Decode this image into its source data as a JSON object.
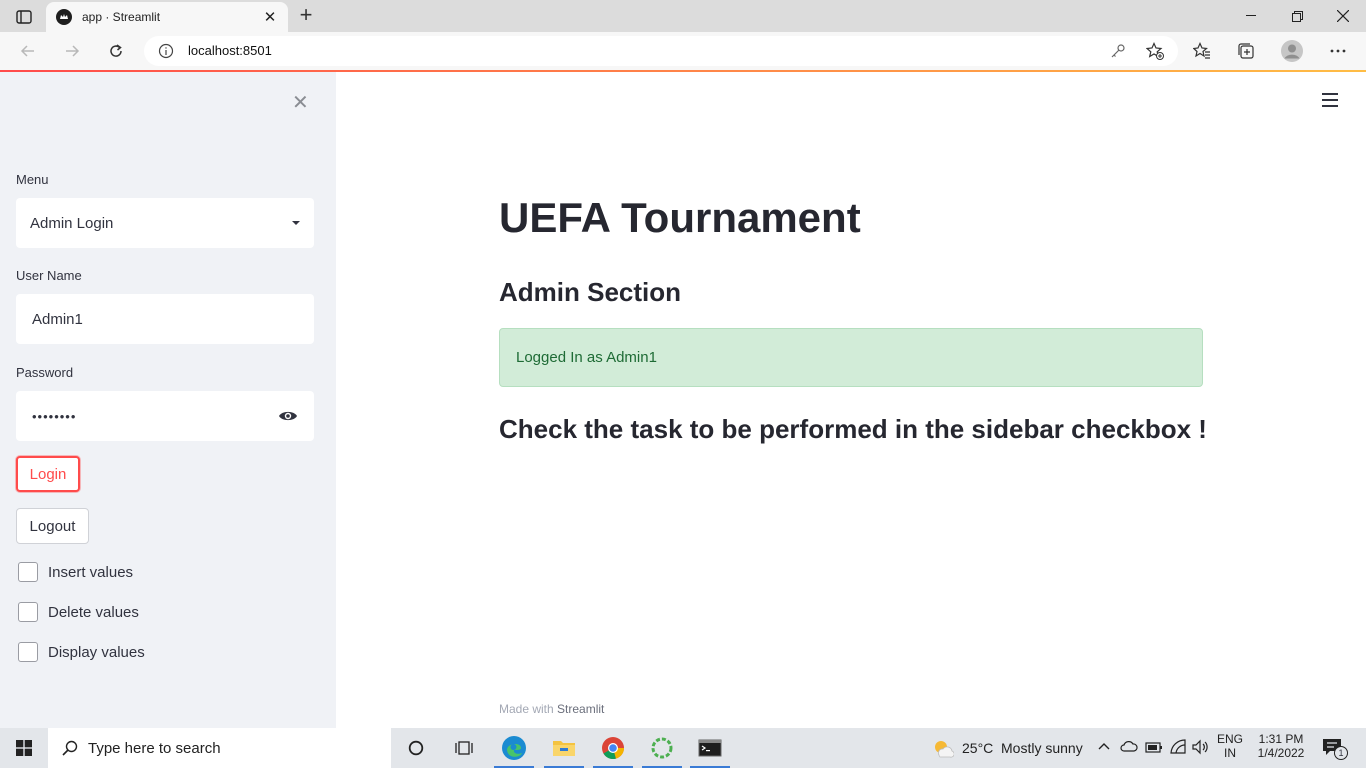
{
  "browser": {
    "tab_title": "app · Streamlit",
    "url": "localhost:8501"
  },
  "sidebar": {
    "menu_label": "Menu",
    "menu_value": "Admin Login",
    "username_label": "User Name",
    "username_value": "Admin1",
    "password_label": "Password",
    "password_value": "••••••••",
    "login_label": "Login",
    "logout_label": "Logout",
    "checkboxes": [
      {
        "label": "Insert values",
        "checked": false
      },
      {
        "label": "Delete values",
        "checked": false
      },
      {
        "label": "Display values",
        "checked": false
      }
    ]
  },
  "main": {
    "title": "UEFA Tournament",
    "subtitle": "Admin Section",
    "alert": "Logged In as Admin1",
    "task_text": "Check the task to be performed in the sidebar checkbox !",
    "footer_prefix": "Made with",
    "footer_brand": "Streamlit"
  },
  "taskbar": {
    "search_placeholder": "Type here to search",
    "temperature": "25°C",
    "weather": "Mostly sunny",
    "lang_top": "ENG",
    "lang_bottom": "IN",
    "time": "1:31 PM",
    "date": "1/4/2022",
    "notification_count": "1"
  },
  "colors": {
    "accent": "#ff4b4b",
    "sidebar_bg": "#f0f2f6",
    "success_bg": "#d2ecd8",
    "success_text": "#1e6b35"
  }
}
